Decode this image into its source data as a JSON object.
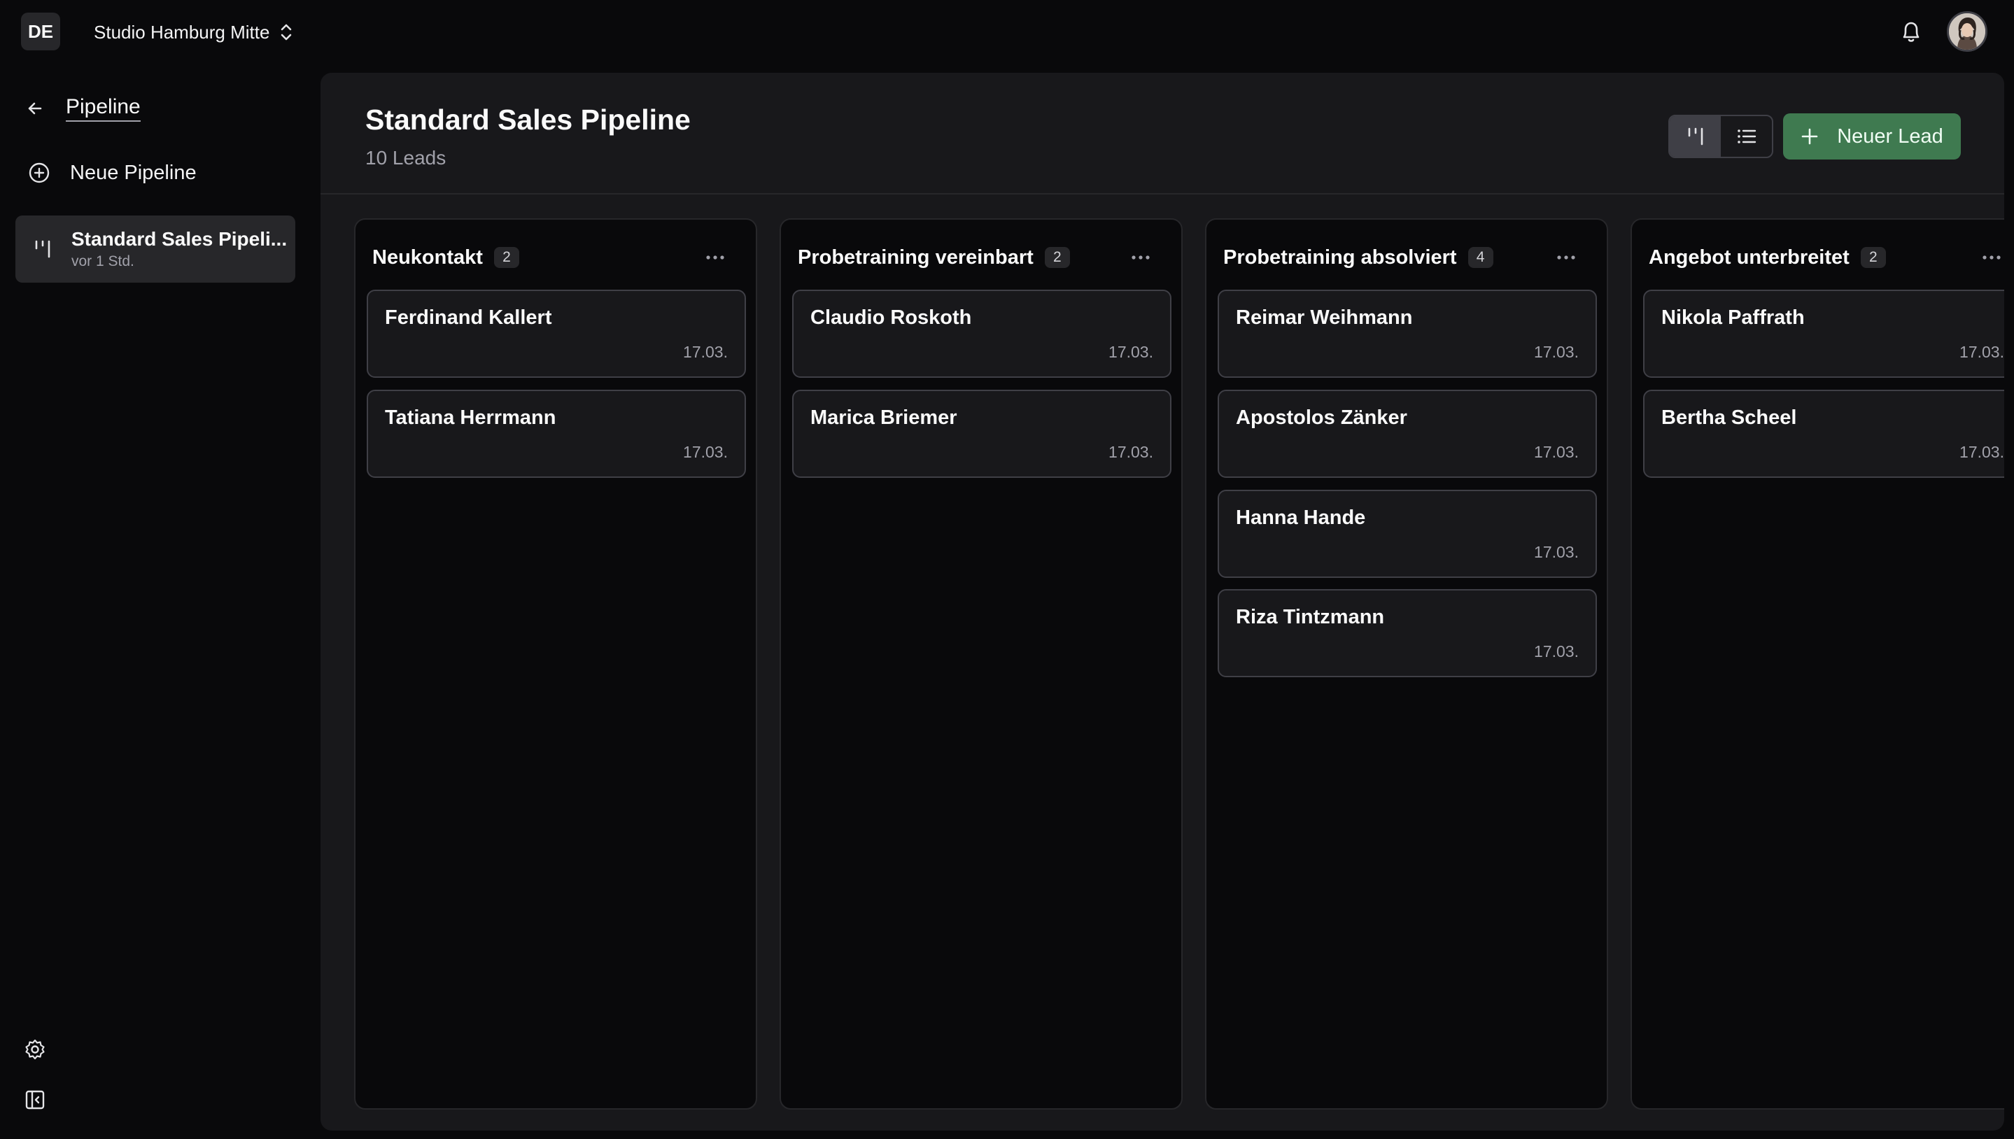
{
  "topbar": {
    "org_initials": "DE",
    "studio_name": "Studio Hamburg Mitte"
  },
  "sidebar": {
    "back_title": "Pipeline",
    "new_pipeline_label": "Neue Pipeline",
    "pipelines": [
      {
        "name": "Standard Sales Pipeli...",
        "updated": "vor 1 Std."
      }
    ]
  },
  "main": {
    "title": "Standard Sales Pipeline",
    "lead_count": "10 Leads",
    "new_lead_label": "Neuer Lead"
  },
  "columns": [
    {
      "title": "Neukontakt",
      "count": "2",
      "cards": [
        {
          "name": "Ferdinand Kallert",
          "date": "17.03."
        },
        {
          "name": "Tatiana Herrmann",
          "date": "17.03."
        }
      ]
    },
    {
      "title": "Probetraining vereinbart",
      "count": "2",
      "cards": [
        {
          "name": "Claudio Roskoth",
          "date": "17.03."
        },
        {
          "name": "Marica Briemer",
          "date": "17.03."
        }
      ]
    },
    {
      "title": "Probetraining absolviert",
      "count": "4",
      "cards": [
        {
          "name": "Reimar Weihmann",
          "date": "17.03."
        },
        {
          "name": "Apostolos Zänker",
          "date": "17.03."
        },
        {
          "name": "Hanna Hande",
          "date": "17.03."
        },
        {
          "name": "Riza Tintzmann",
          "date": "17.03."
        }
      ]
    },
    {
      "title": "Angebot unterbreitet",
      "count": "2",
      "cards": [
        {
          "name": "Nikola Paffrath",
          "date": "17.03."
        },
        {
          "name": "Bertha Scheel",
          "date": "17.03."
        }
      ]
    }
  ],
  "colors": {
    "background": "#09090b",
    "panel": "#18181b",
    "accent_green": "#3f7a50"
  }
}
